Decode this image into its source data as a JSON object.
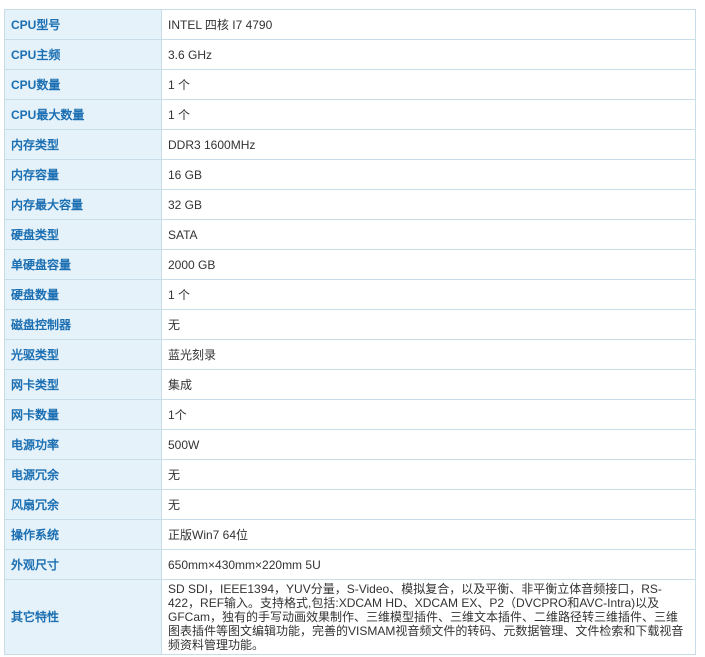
{
  "specs": [
    {
      "label": "CPU型号",
      "value": "INTEL 四核 I7 4790"
    },
    {
      "label": "CPU主频",
      "value": "3.6  GHz"
    },
    {
      "label": "CPU数量",
      "value": "1  个"
    },
    {
      "label": "CPU最大数量",
      "value": "1  个"
    },
    {
      "label": "内存类型",
      "value": "DDR3 1600MHz"
    },
    {
      "label": "内存容量",
      "value": "16  GB"
    },
    {
      "label": "内存最大容量",
      "value": "32  GB"
    },
    {
      "label": "硬盘类型",
      "value": "SATA"
    },
    {
      "label": "单硬盘容量",
      "value": "2000  GB"
    },
    {
      "label": "硬盘数量",
      "value": "1  个"
    },
    {
      "label": "磁盘控制器",
      "value": "无"
    },
    {
      "label": "光驱类型",
      "value": "蓝光刻录"
    },
    {
      "label": "网卡类型",
      "value": "集成"
    },
    {
      "label": "网卡数量",
      "value": "1个"
    },
    {
      "label": "电源功率",
      "value": "500W"
    },
    {
      "label": "电源冗余",
      "value": "无"
    },
    {
      "label": "风扇冗余",
      "value": "无"
    },
    {
      "label": "操作系统",
      "value": "正版Win7 64位"
    },
    {
      "label": "外观尺寸",
      "value": "650mm×430mm×220mm 5U"
    },
    {
      "label": "其它特性",
      "value": "SD SDI，IEEE1394，YUV分量，S-Video、模拟复合，以及平衡、非平衡立体音频接口，RS-422，REF输入。支持格式,包括:XDCAM HD、XDCAM EX、P2（DVCPRO和AVC-Intra)以及GFCam，独有的手写动画效果制作、三维模型插件、三维文本插件、二维路径转三维插件、三维图表插件等图文编辑功能，完善的VISMAM视音频文件的转码、元数据管理、文件检索和下载视音频资料管理功能。"
    }
  ]
}
